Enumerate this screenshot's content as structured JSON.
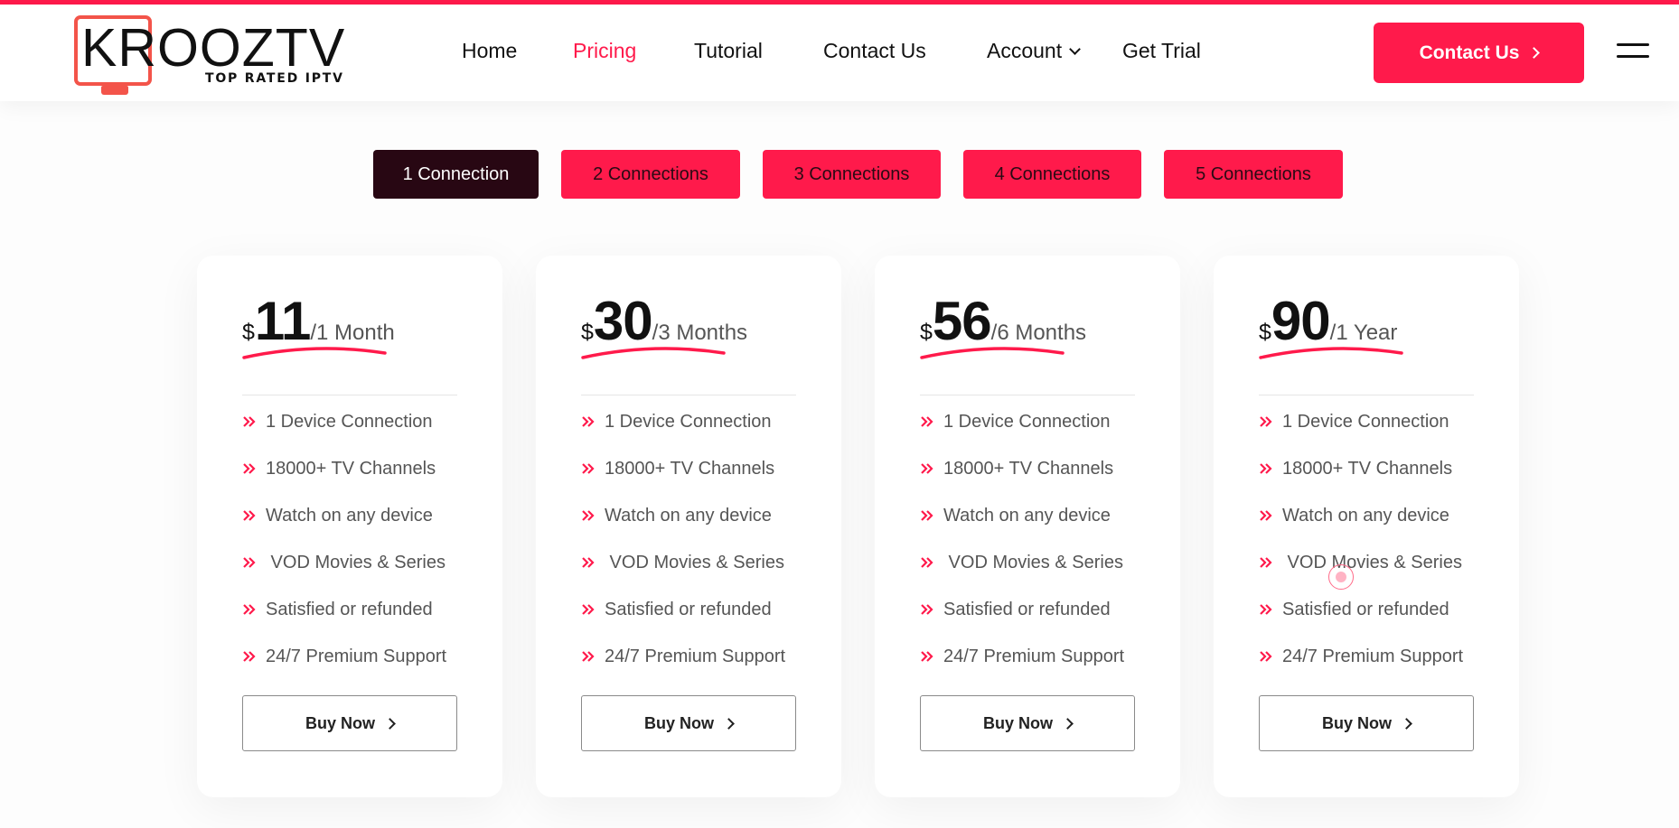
{
  "logo": {
    "main": "KROOZTV",
    "tagline": "TOP RATED IPTV"
  },
  "nav": {
    "items": [
      "Home",
      "Pricing",
      "Tutorial",
      "Contact Us",
      "Account",
      "Get Trial"
    ],
    "active": "Pricing",
    "cta": "Contact Us"
  },
  "tabs": [
    "1 Connection",
    "2 Connections",
    "3 Connections",
    "4 Connections",
    "5 Connections"
  ],
  "active_tab": "1 Connection",
  "plans": [
    {
      "currency": "$",
      "amount": "11",
      "period": "/1 Month"
    },
    {
      "currency": "$",
      "amount": "30",
      "period": "/3 Months"
    },
    {
      "currency": "$",
      "amount": "56",
      "period": "/6 Months"
    },
    {
      "currency": "$",
      "amount": "90",
      "period": "/1 Year"
    }
  ],
  "features": [
    "1 Device Connection",
    "18000+ TV Channels",
    "Watch on any device",
    " VOD Movies & Series",
    "Satisfied or refunded",
    "24/7 Premium Support"
  ],
  "buy_label": "Buy Now",
  "colors": {
    "accent": "#ff1a4b",
    "dark_tab": "#280713",
    "logo": "#f3544a"
  },
  "icons": {
    "feature_bullet": "double-chevron-right-icon",
    "button_arrow": "chevron-right-icon",
    "menu": "hamburger-icon"
  }
}
